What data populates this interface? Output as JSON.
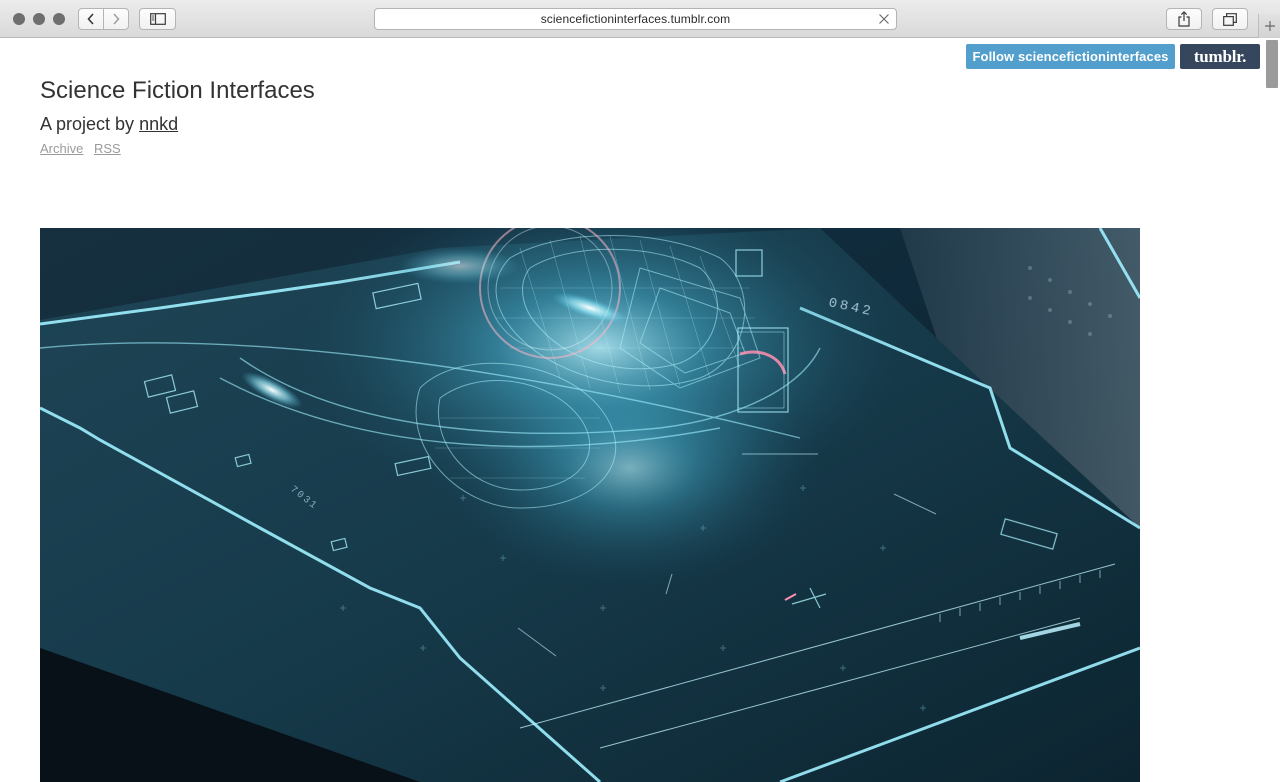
{
  "browser": {
    "url": "sciencefictioninterfaces.tumblr.com"
  },
  "tumblr_controls": {
    "follow_label": "Follow sciencefictioninterfaces",
    "logo_label": "tumblr."
  },
  "blog": {
    "title": "Science Fiction Interfaces",
    "subtitle_prefix": "A project by ",
    "author": "nnkd",
    "links": [
      "Archive",
      "RSS"
    ]
  },
  "post": {
    "hud_readouts": [
      "0842",
      "7031"
    ]
  },
  "colors": {
    "follow_button": "#529ecc",
    "tumblr_button": "#36465d",
    "hud_glow": "#7fe6ff"
  },
  "icons": {
    "back": "chevron-left-icon",
    "forward": "chevron-right-icon",
    "sidebar": "sidebar-icon",
    "share": "share-icon",
    "tabs": "tabs-icon",
    "clear": "close-icon",
    "new_tab": "plus-icon"
  }
}
